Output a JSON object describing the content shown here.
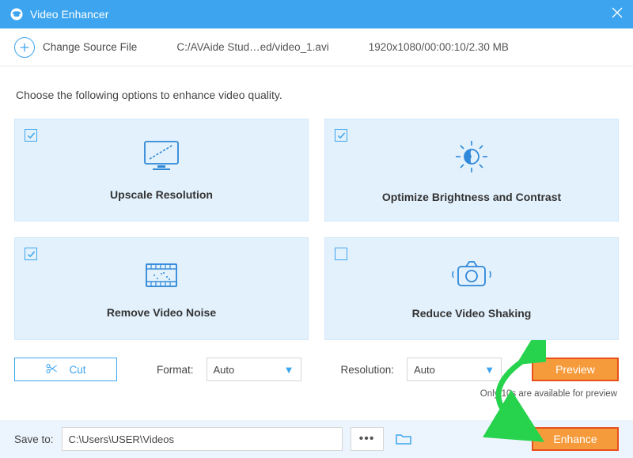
{
  "titlebar": {
    "title": "Video Enhancer"
  },
  "source": {
    "change_label": "Change Source File",
    "path": "C:/AVAide Stud…ed/video_1.avi",
    "meta": "1920x1080/00:00:10/2.30 MB"
  },
  "instruction": "Choose the following options to enhance video quality.",
  "cards": [
    {
      "label": "Upscale Resolution",
      "checked": true
    },
    {
      "label": "Optimize Brightness and Contrast",
      "checked": true
    },
    {
      "label": "Remove Video Noise",
      "checked": true
    },
    {
      "label": "Reduce Video Shaking",
      "checked": false
    }
  ],
  "controls": {
    "cut": "Cut",
    "format_label": "Format:",
    "format_value": "Auto",
    "resolution_label": "Resolution:",
    "resolution_value": "Auto",
    "preview": "Preview",
    "hint": "Only 10s are available for preview"
  },
  "save": {
    "label": "Save to:",
    "path": "C:\\Users\\USER\\Videos",
    "enhance": "Enhance"
  }
}
